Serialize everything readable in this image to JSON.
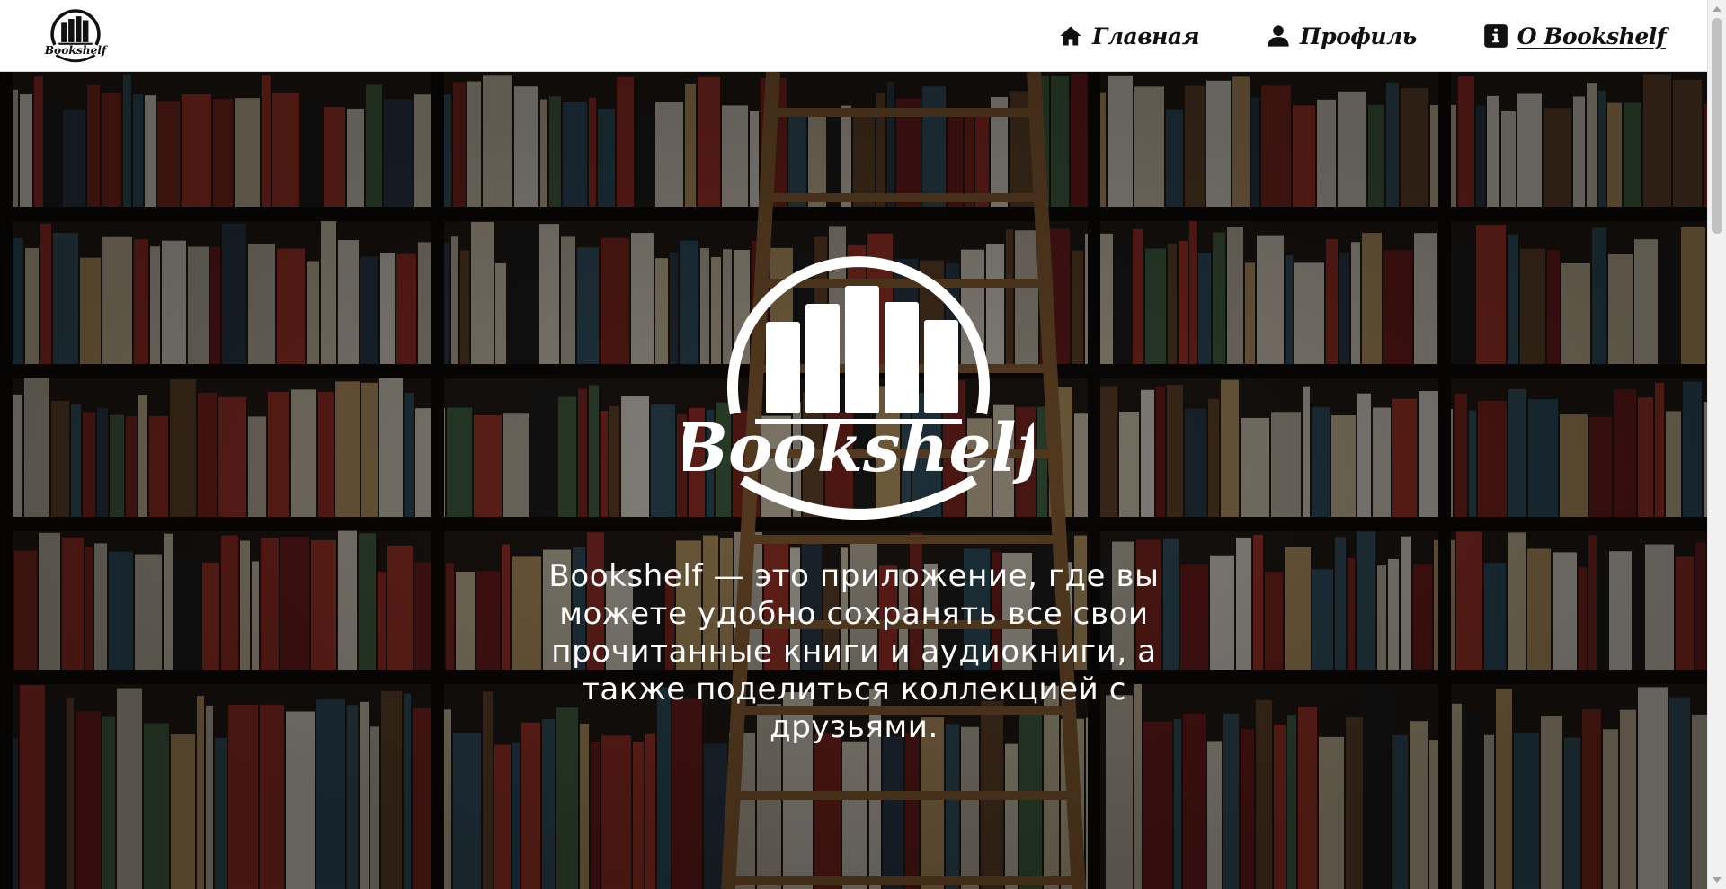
{
  "header": {
    "logo_text": "Bookshelf",
    "nav": [
      {
        "label": "Главная",
        "icon": "home-icon",
        "active": false
      },
      {
        "label": "Профиль",
        "icon": "user-icon",
        "active": false
      },
      {
        "label": "О Bookshelf",
        "icon": "info-icon",
        "active": true
      }
    ]
  },
  "hero": {
    "logo_text": "Bookshelf",
    "description": "Bookshelf — это приложение, где вы можете удобно сохранять все свои прочитанные книги и аудиокниги, а также поделиться коллекцией с друзьями."
  },
  "colors": {
    "header_bg": "#ffffff",
    "hero_overlay": "#000000",
    "text_light": "#ffffff",
    "text_dark": "#111111"
  }
}
